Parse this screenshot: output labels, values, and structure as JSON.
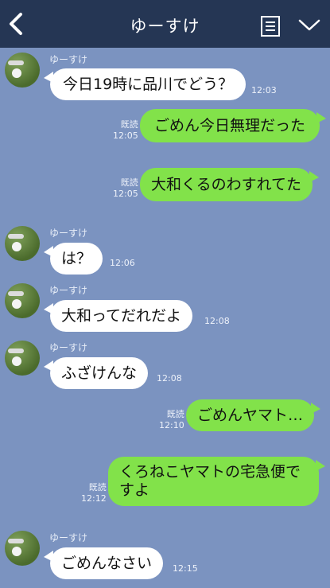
{
  "header": {
    "title": "ゆーすけ",
    "back_icon": "chevron-left-icon",
    "menu_icon": "list-icon",
    "collapse_icon": "chevron-down-icon",
    "bg_color": "#253654"
  },
  "colors": {
    "chat_bg": "#7b93c0",
    "incoming": "#ffffff",
    "outgoing": "#82e24a"
  },
  "messages": [
    {
      "sender": "ゆーすけ",
      "text": "今日19時に品川でどう？",
      "time": "12:03"
    },
    {
      "read": "既読",
      "text": "ごめん今日無理だった",
      "time": "12:05"
    },
    {
      "read": "既読",
      "text": "大和くるのわすれてた",
      "time": "12:05"
    },
    {
      "sender": "ゆーすけ",
      "text": "は？",
      "time": "12:06"
    },
    {
      "sender": "ゆーすけ",
      "text": "大和ってだれだよ",
      "time": "12:08"
    },
    {
      "sender": "ゆーすけ",
      "text": "ふざけんな",
      "time": "12:08"
    },
    {
      "read": "既読",
      "text": "ごめんヤマト…",
      "time": "12:10"
    },
    {
      "read": "既読",
      "text_line1": "くろねこヤマトの宅急便で",
      "text_line2": "すよ",
      "time": "12:12"
    },
    {
      "sender": "ゆーすけ",
      "text": "ごめんなさい",
      "time": "12:15"
    }
  ]
}
